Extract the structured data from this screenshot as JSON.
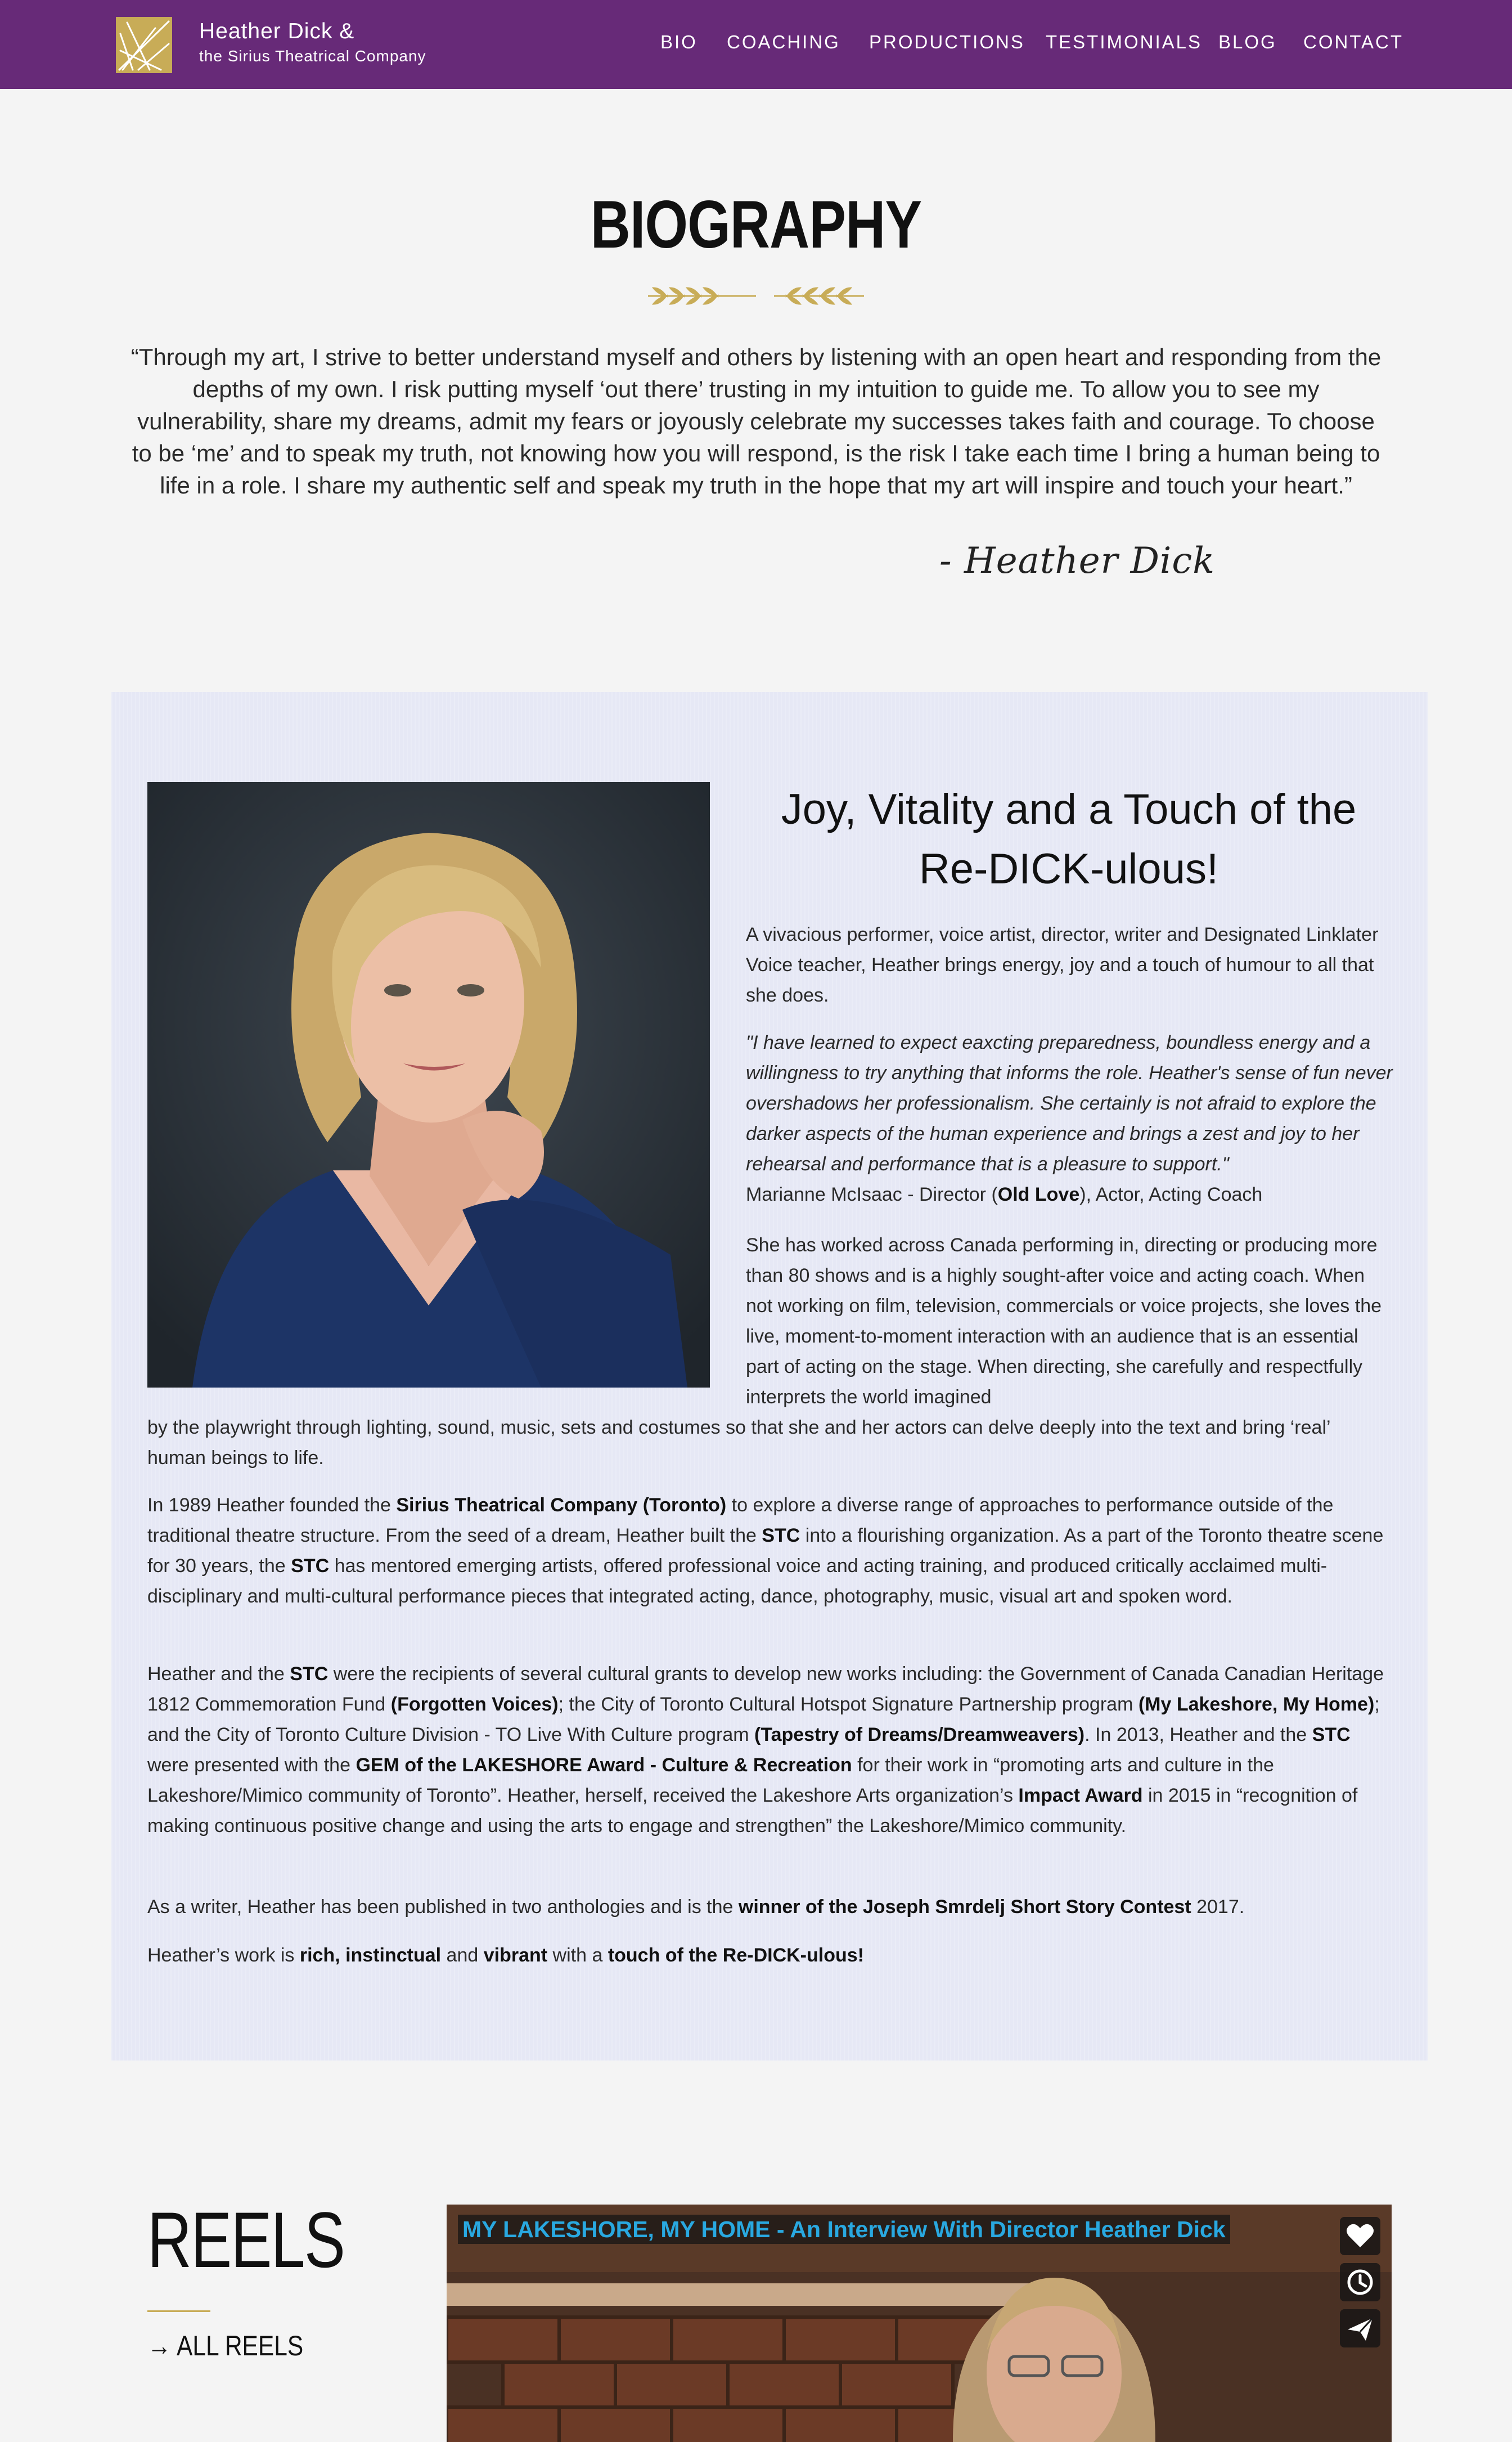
{
  "header": {
    "brand_name": "Heather Dick &",
    "brand_subtitle": "the Sirius Theatrical Company",
    "nav": [
      "BIO",
      "COACHING",
      "PRODUCTIONS",
      "TESTIMONIALS",
      "BLOG",
      "CONTACT"
    ]
  },
  "bio": {
    "title": "BIOGRAPHY",
    "quote": "“Through my art, I strive to better understand myself and others by listening with an open heart and responding from the depths of my own. I risk putting myself ‘out there’ trusting in my intuition to guide me. To allow you to see my vulnerability, share my dreams, admit my fears or joyously celebrate my successes takes faith and courage. To choose to be ‘me’ and to speak my truth, not knowing how you will respond, is the risk I take each time I bring a human being to life in a role. I share my authentic self and speak my truth in the hope that my art will inspire and touch your heart.”",
    "signature": "- Heather Dick"
  },
  "panel": {
    "heading": "Joy, Vitality and a Touch of the Re-DICK-ulous!",
    "p1": "A vivacious performer, voice artist, director, writer and Designated Linklater Voice teacher, Heather brings energy, joy and a touch of humour to all that she does.",
    "testimonial": "\"I have learned to expect eaxcting preparedness, boundless energy and a willingness to try anything that informs the role. Heather's sense of fun never overshadows her professionalism. She certainly is not afraid to explore the darker aspects of the human experience and brings a zest and joy to her rehearsal and performance that is a pleasure to support.\"",
    "testimonial_author_pre": "Marianne McIsaac - Director (",
    "testimonial_author_show": "Old Love",
    "testimonial_author_post": "), Actor, Acting Coach",
    "p3_part1": "She has worked across Canada performing in, directing or producing more than 80 shows and is a highly sought-after voice and acting coach. When not working on film, television, commercials or voice projects, she loves the live, moment-to-moment interaction with an audience that is an essential part of acting on the stage. When directing, she carefully and respectfully interprets the world imagined",
    "p3_part2": "by the playwright through lighting, sound, music, sets and costumes so that she and her actors can delve deeply into the text and bring ‘real’ human beings to life.",
    "p4": [
      {
        "t": "In 1989 Heather founded the ",
        "b": false
      },
      {
        "t": "Sirius Theatrical Company (Toronto)",
        "b": true
      },
      {
        "t": " to explore a diverse range of approaches to performance outside of the traditional theatre structure. From the seed of a dream, Heather built the ",
        "b": false
      },
      {
        "t": "STC",
        "b": true
      },
      {
        "t": " into a flourishing organization. As a part of the Toronto theatre scene for 30 years, the ",
        "b": false
      },
      {
        "t": "STC",
        "b": true
      },
      {
        "t": " has mentored emerging artists, offered professional voice and acting training, and produced critically acclaimed multi-disciplinary and multi-cultural performance pieces that integrated acting, dance, photography, music, visual art and spoken word.",
        "b": false
      }
    ],
    "p5": [
      {
        "t": "Heather and the ",
        "b": false
      },
      {
        "t": "STC",
        "b": true
      },
      {
        "t": " were the recipients of several cultural grants to develop new works including: the Government of Canada Canadian Heritage 1812 Commemoration Fund ",
        "b": false
      },
      {
        "t": "(Forgotten Voices)",
        "b": true
      },
      {
        "t": "; the City of Toronto Cultural Hotspot Signature Partnership program ",
        "b": false
      },
      {
        "t": "(My Lakeshore, My Home)",
        "b": true
      },
      {
        "t": "; and the City of Toronto Culture Division - TO Live With Culture program ",
        "b": false
      },
      {
        "t": "(Tapestry of Dreams/Dreamweavers)",
        "b": true
      },
      {
        "t": ". In 2013, Heather and the ",
        "b": false
      },
      {
        "t": "STC",
        "b": true
      },
      {
        "t": " were presented with the ",
        "b": false
      },
      {
        "t": "GEM of the LAKESHORE Award - Culture & Recreation",
        "b": true
      },
      {
        "t": " for their work in “promoting arts and culture in the Lakeshore/Mimico community of Toronto”. Heather, herself, received the Lakeshore Arts organization’s ",
        "b": false
      },
      {
        "t": "Impact Award",
        "b": true
      },
      {
        "t": " in 2015 in “recognition of making continuous positive change and using the arts to engage and strengthen” the Lakeshore/Mimico community.",
        "b": false
      }
    ],
    "p6": [
      {
        "t": "As a writer, Heather has been published in two anthologies and is the ",
        "b": false
      },
      {
        "t": "winner of the Joseph Smrdelj Short Story Contest",
        "b": true
      },
      {
        "t": " 2017.",
        "b": false
      }
    ],
    "p7": [
      {
        "t": "Heather’s work is ",
        "b": false
      },
      {
        "t": "rich, instinctual",
        "b": true
      },
      {
        "t": " and ",
        "b": false
      },
      {
        "t": "vibrant",
        "b": true
      },
      {
        "t": " with a ",
        "b": false
      },
      {
        "t": "touch of the Re-DICK-ulous!",
        "b": true
      }
    ]
  },
  "reels": {
    "title": "REELS",
    "link_arrow": "→",
    "link_label": "ALL REELS",
    "video_title": "MY LAKESHORE, MY HOME - An Interview With Director Heather Dick",
    "video_buttons": [
      "heart-icon",
      "clock-icon",
      "send-icon"
    ]
  },
  "colors": {
    "header_bg": "#672a78",
    "accent_gold": "#c8ac57",
    "panel_bg": "#e6e8f5",
    "page_bg": "#f4f4f4",
    "video_title_color": "#29a8e0"
  }
}
